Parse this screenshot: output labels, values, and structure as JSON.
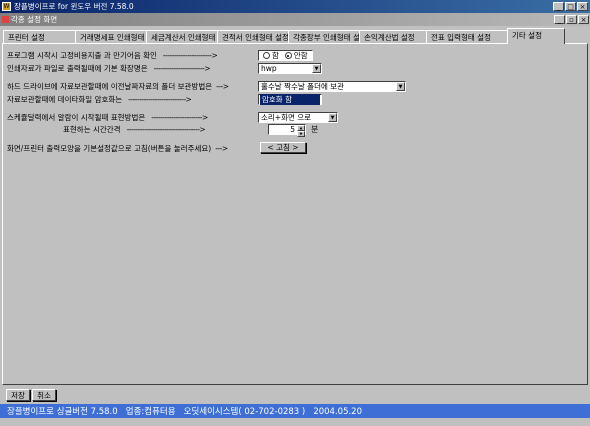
{
  "window": {
    "title": "장플병이프로 for 윈도우 버전 7.58.0",
    "mdi_title": "각종 설정 화면",
    "min": "_",
    "max": "□",
    "close": "×",
    "restore": "▫"
  },
  "tabs": [
    {
      "label": "프린터 설정",
      "active": false
    },
    {
      "label": "거래명세표 인쇄형태",
      "active": false
    },
    {
      "label": "세금계산서 인쇄형태",
      "active": false
    },
    {
      "label": "견적서 인쇄형태 설정",
      "active": false
    },
    {
      "label": "각종장부 인쇄형태 설",
      "active": false
    },
    {
      "label": "손익계산법 설정",
      "active": false
    },
    {
      "label": "전표 입력형태 설정",
      "active": false
    },
    {
      "label": "기타 설정",
      "active": true
    }
  ],
  "settings": {
    "fixed_cost": {
      "label": "프로그램 시작시 고정비용지출 과 만기어음 확인",
      "dashes": "---------------------->",
      "opt_yes": "함",
      "opt_no": "안함",
      "selected": "안함"
    },
    "file_ext": {
      "label": "인쇄자료가 파일로 출력될때에 기본 확장명은",
      "dashes": "----------------------->",
      "value": "hwp"
    },
    "backup_folder": {
      "label": "하드 드라이브에 자료보관할때에 이전날짜자료의 폴더 보관방법은",
      "dashes": "--->",
      "value": "홀수날 짝수날 폴더에 보관"
    },
    "encrypt": {
      "label": "자료보관할때에 데이타화일 암호화는",
      "dashes": "-------------------------->",
      "value": "암호화 함"
    },
    "alarm": {
      "label": "스케쥴달력에서 알람이 시작될때 표현방법은",
      "dashes": "----------------------->",
      "value": "소리+화면 으로"
    },
    "interval": {
      "label": "표현하는 시간간격",
      "dashes": "--------------------------------->",
      "value": "5",
      "unit": "분"
    },
    "reset": {
      "label": "화면/프린터 출력모양을 기본설정값으로 고침(버튼을 눌러주세요)",
      "dashes": "--->",
      "button": "< 고침 >"
    }
  },
  "buttons": {
    "save": "저장",
    "cancel": "취소"
  },
  "statusbar": "장플병이프로 싱글버전 7.58.0   업종:컴퓨터용   오딧세이시스템( 02-702-0283 )   2004.05.20"
}
